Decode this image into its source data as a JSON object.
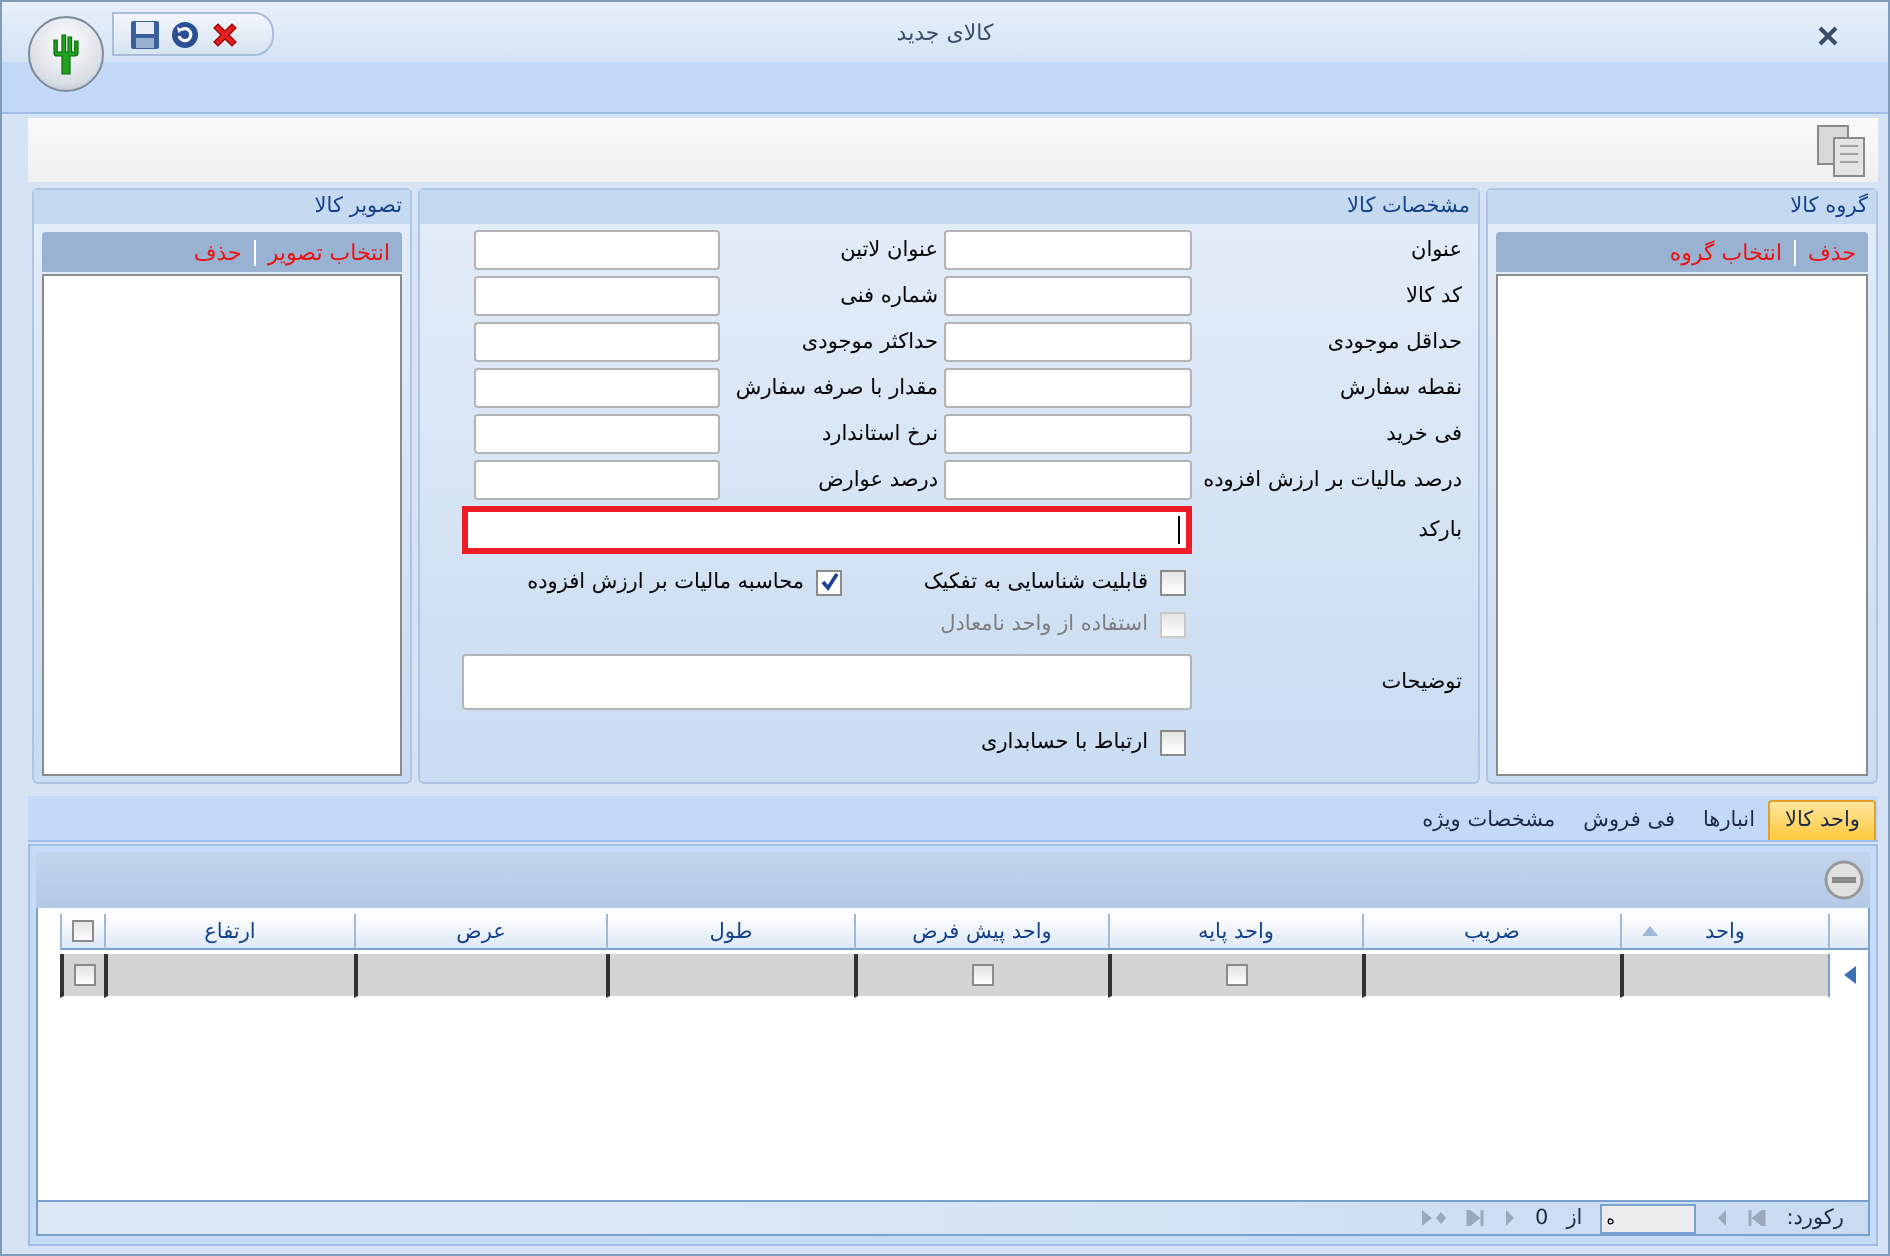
{
  "window": {
    "title": "کالای جدید"
  },
  "group_panel": {
    "title": "گروه کالا",
    "actions": [
      "حذف",
      "انتخاب گروه"
    ]
  },
  "details": {
    "title": "مشخصات کالا",
    "fields": [
      {
        "label": "عنوان"
      },
      {
        "label": "عنوان لاتین"
      },
      {
        "label": "کد کالا"
      },
      {
        "label": "شماره فنی"
      },
      {
        "label": "حداقل موجودی"
      },
      {
        "label": "حداکثر موجودی"
      },
      {
        "label": "نقطه سفارش"
      },
      {
        "label": "مقدار با صرفه سفارش"
      },
      {
        "label": "فی خرید"
      },
      {
        "label": "نرخ استاندارد"
      },
      {
        "label": "درصد مالیات بر ارزش افزوده"
      },
      {
        "label": "درصد عوارض"
      }
    ],
    "barcode": {
      "label": "بارکد",
      "focused": true
    },
    "option_rows": [
      [
        {
          "label": "قابلیت شناسایی به تفکیک",
          "checked": false,
          "disabled": false
        },
        {
          "label": "محاسبه مالیات بر ارزش افزوده",
          "checked": true,
          "disabled": false
        }
      ],
      [
        {
          "label": "استفاده از واحد نامعادل",
          "checked": false,
          "disabled": true
        }
      ]
    ],
    "notes": {
      "label": "توضیحات"
    },
    "accounting": {
      "label": "ارتباط با حسابداری",
      "checked": false
    }
  },
  "image_panel": {
    "title": "تصویر کالا",
    "actions": [
      "انتخاب تصویر",
      "حذف"
    ]
  },
  "tabs": [
    {
      "label": "واحد کالا",
      "selected": true
    },
    {
      "label": "انبارها",
      "selected": false
    },
    {
      "label": "فی فروش",
      "selected": false
    },
    {
      "label": "مشخصات ویژه",
      "selected": false
    }
  ],
  "table": {
    "columns": [
      {
        "label": "واحد",
        "sorted": true
      },
      {
        "label": "ضریب",
        "sorted": false
      },
      {
        "label": "واحد پایه",
        "sorted": false
      },
      {
        "label": "واحد پیش فرض",
        "sorted": false
      },
      {
        "label": "طول",
        "sorted": false
      },
      {
        "label": "عرض",
        "sorted": false
      },
      {
        "label": "ارتفاع",
        "sorted": false
      }
    ],
    "header_checked": false,
    "rows": [
      {
        "checked": false,
        "cells": [
          {
            "kind": "blank"
          },
          {
            "kind": "blank"
          },
          {
            "kind": "checkbox",
            "checked": false
          },
          {
            "kind": "checkbox",
            "checked": false
          },
          {
            "kind": "blank"
          },
          {
            "kind": "blank"
          },
          {
            "kind": "blank"
          }
        ]
      }
    ]
  },
  "pager": {
    "label": "رکورد:",
    "value": "ه",
    "of": "از",
    "total": "0"
  }
}
